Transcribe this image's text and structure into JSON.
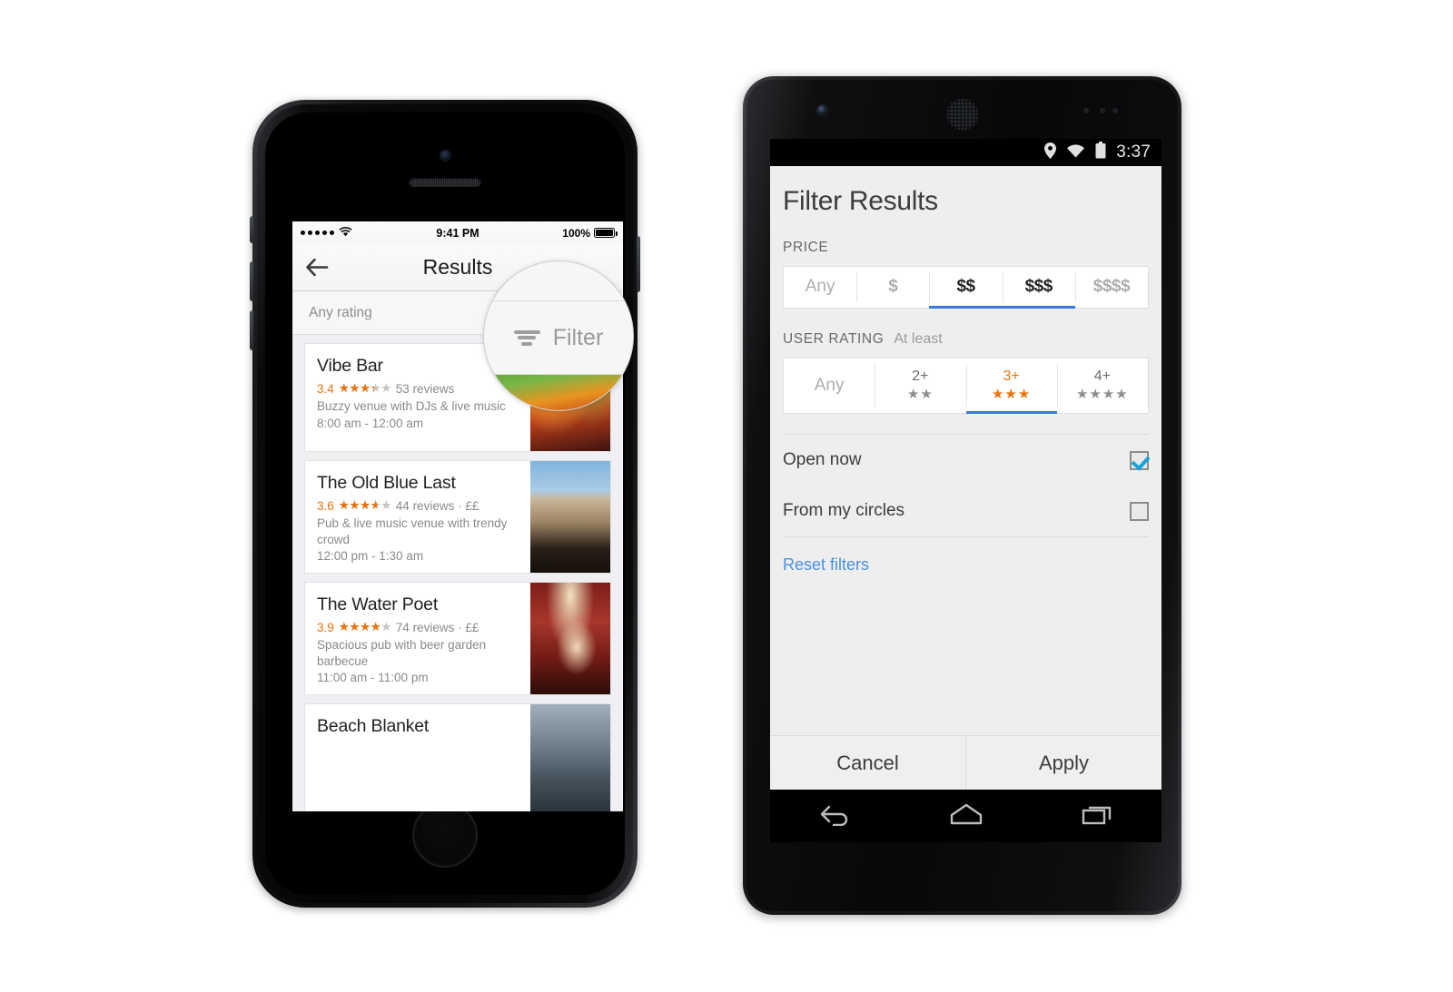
{
  "iphone": {
    "status": {
      "signal_dots": 5,
      "wifi_icon": "wifi-icon",
      "time": "9:41 PM",
      "battery_percent": "100%"
    },
    "nav": {
      "back_icon": "back-arrow-icon",
      "title": "Results"
    },
    "filter_bar": {
      "rating_label": "Any rating",
      "filter_icon": "filter-icon",
      "filter_label": "Filter"
    },
    "magnifier": {
      "filter_icon": "filter-icon",
      "filter_label": "Filter"
    },
    "results": [
      {
        "name": "Vibe Bar",
        "score": "3.4",
        "stars": 3.4,
        "reviews": "53 reviews",
        "price": "",
        "description": "Buzzy venue with DJs & live music",
        "hours": "8:00 am - 12:00 am",
        "thumb": "th1"
      },
      {
        "name": "The Old Blue Last",
        "score": "3.6",
        "stars": 3.6,
        "reviews": "44 reviews",
        "price": " · ££",
        "description": "Pub & live music venue with trendy crowd",
        "hours": "12:00 pm - 1:30 am",
        "thumb": "th2"
      },
      {
        "name": "The Water Poet",
        "score": "3.9",
        "stars": 3.9,
        "reviews": "74 reviews",
        "price": " · ££",
        "description": "Spacious pub with beer garden barbecue",
        "hours": "11:00 am - 11:00 pm",
        "thumb": "th3"
      },
      {
        "name": "Beach Blanket",
        "score": "",
        "stars": 0,
        "reviews": "",
        "price": "",
        "description": "",
        "hours": "",
        "thumb": "th4"
      }
    ]
  },
  "android": {
    "status": {
      "location_icon": "location-pin-icon",
      "wifi_icon": "wifi-icon",
      "battery_icon": "battery-icon",
      "time": "3:37"
    },
    "title": "Filter Results",
    "price": {
      "label": "PRICE",
      "options": [
        {
          "label": "Any",
          "selected": false
        },
        {
          "label": "$",
          "selected": false
        },
        {
          "label": "$$",
          "selected": true
        },
        {
          "label": "$$$",
          "selected": true
        },
        {
          "label": "$$$$",
          "selected": false
        }
      ]
    },
    "user_rating": {
      "label": "USER RATING",
      "sublabel": "At least",
      "options": [
        {
          "label": "Any",
          "stars": "",
          "selected": false
        },
        {
          "label": "2+",
          "stars": "★★",
          "selected": false
        },
        {
          "label": "3+",
          "stars": "★★★",
          "selected": true
        },
        {
          "label": "4+",
          "stars": "★★★★",
          "selected": false
        }
      ]
    },
    "toggles": [
      {
        "label": "Open now",
        "checked": true
      },
      {
        "label": "From my circles",
        "checked": false
      }
    ],
    "reset_label": "Reset filters",
    "footer": {
      "cancel_label": "Cancel",
      "apply_label": "Apply"
    },
    "navbar": {
      "back_icon": "back-icon",
      "home_icon": "home-icon",
      "recents_icon": "recents-icon"
    }
  },
  "colors": {
    "accent_blue": "#3b78e7",
    "link_blue": "#4a90e2",
    "star_orange": "#e8730c",
    "checkbox_blue": "#16a3d8"
  }
}
